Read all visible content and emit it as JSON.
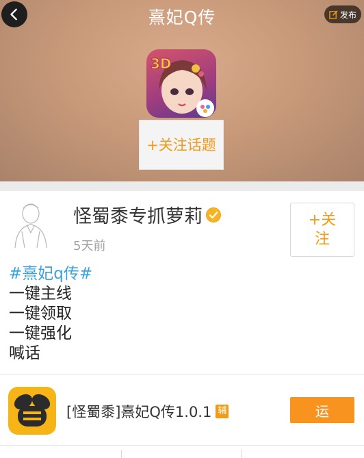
{
  "header": {
    "title": "熹妃Q传",
    "publish_label": "发布"
  },
  "topic": {
    "follow_label": "+关注话题"
  },
  "post": {
    "username": "怪蜀黍专抓萝莉",
    "time": "5天前",
    "follow_label": "+关注",
    "hashtag": "#熹妃q传#",
    "lines": [
      "一键主线",
      "一键领取",
      "一键强化",
      "喊话"
    ]
  },
  "app": {
    "name": "[怪蜀黍]熹妃Q传1.0.1",
    "badge": "辅",
    "run_label": "运"
  },
  "colors": {
    "accent": "#f39a17",
    "hashtag": "#3aa3df"
  }
}
